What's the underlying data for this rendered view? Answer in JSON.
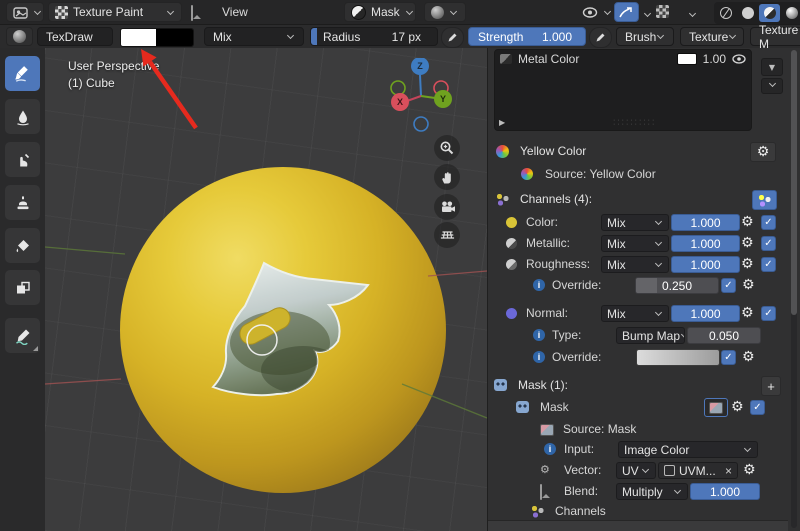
{
  "colors": {
    "accent_blue": "#4e77ba",
    "sphere_yellow": "#d6b226",
    "annotation_red": "#e62a1e",
    "axis_x": "#d94f5c",
    "axis_y": "#6fa21f",
    "axis_z": "#3e7cc1"
  },
  "icons": {
    "gear": "⚙",
    "check": "✓",
    "plus": "+",
    "close": "×",
    "tri_right": "▶",
    "tri_down": "▼",
    "grip": "··········"
  },
  "header": {
    "mode": "Texture Paint",
    "view": "View",
    "mask": "Mask"
  },
  "tool_settings": {
    "brush_name": "TexDraw",
    "blend_mode": "Mix",
    "radius_label": "Radius",
    "radius_value": "17 px",
    "strength_label": "Strength",
    "strength_value": "1.000",
    "brush_panel": "Brush",
    "texture_panel": "Texture",
    "texture_mask_panel": "Texture M",
    "primary_color": "#ffffff",
    "secondary_color": "#000000"
  },
  "viewport": {
    "perspective": "User Perspective",
    "object": "(1) Cube",
    "x": "X",
    "y": "Y",
    "z": "Z"
  },
  "panel": {
    "layer": {
      "name": "Metal Color",
      "value": "1.00"
    },
    "yellow_title": "Yellow Color",
    "yellow_source": "Source: Yellow Color",
    "channels_title": "Channels (4):",
    "color": {
      "label": "Color:",
      "mode": "Mix",
      "value": "1.000"
    },
    "metallic": {
      "label": "Metallic:",
      "mode": "Mix",
      "value": "1.000"
    },
    "roughness": {
      "label": "Roughness:",
      "mode": "Mix",
      "value": "1.000"
    },
    "rough_override": {
      "label": "Override:",
      "value": "0.250"
    },
    "normal": {
      "label": "Normal:",
      "mode": "Mix",
      "value": "1.000"
    },
    "type": {
      "label": "Type:",
      "mode": "Bump Map",
      "value": "0.050"
    },
    "normal_override": {
      "label": "Override:"
    },
    "mask_title": "Mask (1):",
    "mask_name": "Mask",
    "mask_source": "Source: Mask",
    "input": {
      "label": "Input:",
      "value": "Image Color"
    },
    "vector": {
      "label": "Vector:",
      "mode": "UV",
      "map": "UVM..."
    },
    "blend": {
      "label": "Blend:",
      "mode": "Multiply",
      "value": "1.000"
    },
    "channels_footer": "Channels"
  }
}
